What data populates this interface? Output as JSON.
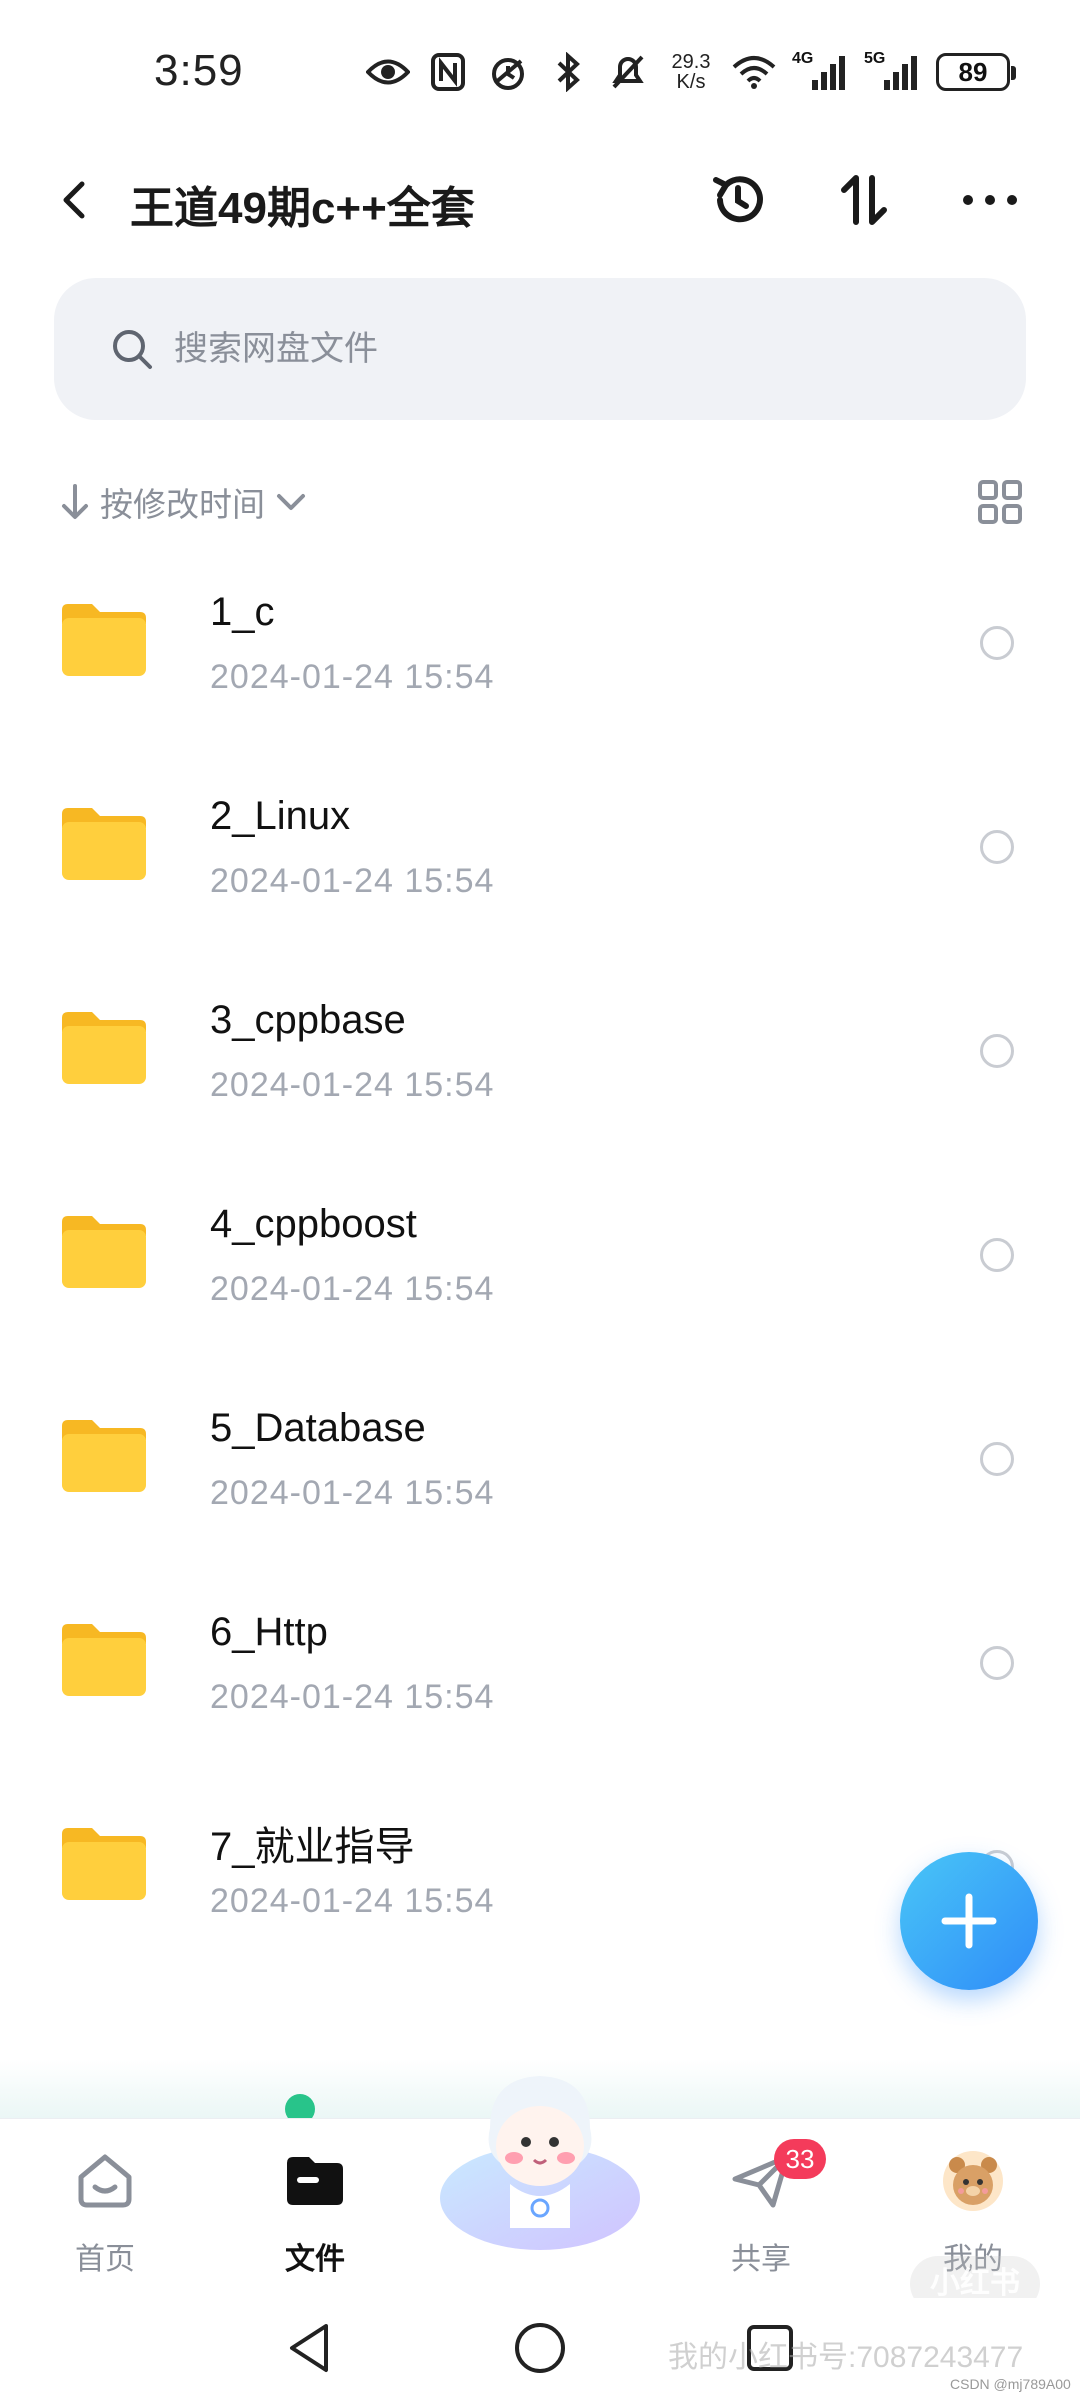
{
  "status_bar": {
    "time": "3:59",
    "net_speed_value": "29.3",
    "net_speed_unit": "K/s",
    "signal_1_label": "4G",
    "signal_2_label": "5G",
    "battery": "89",
    "icons": [
      "eye-icon",
      "nfc-icon",
      "alarm-icon",
      "bluetooth-icon",
      "mute-icon",
      "wifi-icon",
      "signal-icon",
      "battery-icon"
    ]
  },
  "header": {
    "title": "王道49期c++全套",
    "actions": [
      "history-icon",
      "sort-icon",
      "more-icon"
    ]
  },
  "search": {
    "placeholder": "搜索网盘文件"
  },
  "sort": {
    "label": "按修改时间"
  },
  "files": [
    {
      "name": "1_c",
      "date": "2024-01-24  15:54"
    },
    {
      "name": "2_Linux",
      "date": "2024-01-24  15:54"
    },
    {
      "name": "3_cppbase",
      "date": "2024-01-24  15:54"
    },
    {
      "name": "4_cppboost",
      "date": "2024-01-24  15:54"
    },
    {
      "name": "5_Database",
      "date": "2024-01-24  15:54"
    },
    {
      "name": "6_Http",
      "date": "2024-01-24  15:54"
    },
    {
      "name": "7_就业指导",
      "date": "2024-01-24  15:54"
    }
  ],
  "tabs": {
    "home": "首页",
    "files": "文件",
    "share": "共享",
    "share_badge": "33",
    "mine": "我的"
  },
  "watermark": {
    "text": "我的小红书号:7087243477",
    "logo": "小红书",
    "csdn": "CSDN @mj789A00"
  },
  "colors": {
    "accent": "#2f8cf8",
    "folder": "#ffcf3d",
    "badge": "#f43b5b",
    "muted": "#8a8f99"
  }
}
